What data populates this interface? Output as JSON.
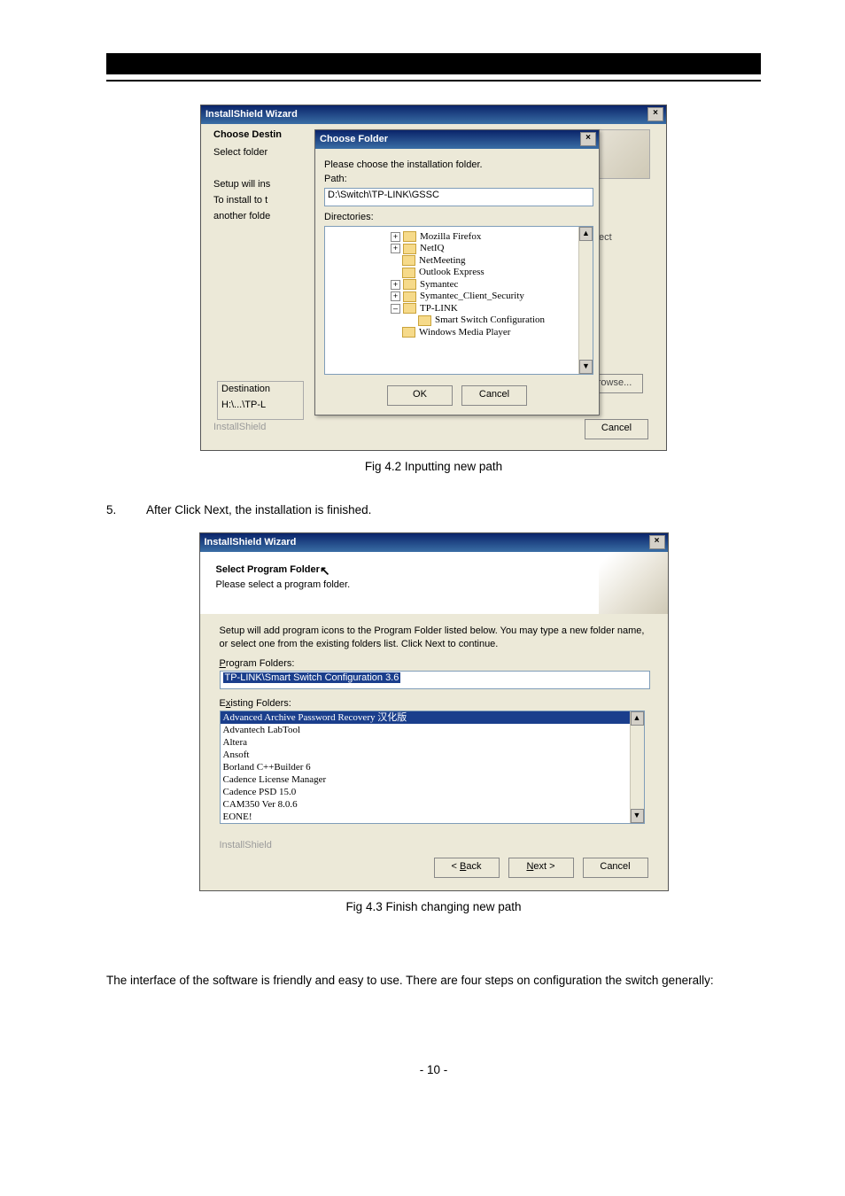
{
  "figure1": {
    "outer_title": "InstallShield Wizard",
    "left": {
      "header": "Choose Destin",
      "select_folder": "Select folder",
      "setup_will": "Setup will ins",
      "to_install": "To install to t",
      "another": "another folde",
      "dest_label": "Destination",
      "dest_path": "H:\\...\\TP-L",
      "installshield": "InstallShield"
    },
    "right": {
      "select": "select",
      "browse": "rowse...",
      "cancel": "Cancel"
    },
    "inner": {
      "title": "Choose Folder",
      "prompt": "Please choose the installation folder.",
      "path_label": "Path:",
      "path_value": "D:\\Switch\\TP-LINK\\GSSC",
      "dirs_label": "Directories:",
      "tree": {
        "n0": "Mozilla Firefox",
        "n1": "NetIQ",
        "n2": "NetMeeting",
        "n3": "Outlook Express",
        "n4": "Symantec",
        "n5": "Symantec_Client_Security",
        "n6": "TP-LINK",
        "n6a": "Smart Switch Configuration",
        "n7": "Windows Media Player"
      },
      "ok": "OK",
      "cancel": "Cancel"
    },
    "caption": "Fig 4.2 Inputting new path"
  },
  "step5": {
    "num": "5.",
    "text": "After Click Next, the installation is finished."
  },
  "figure2": {
    "title": "InstallShield Wizard",
    "header": "Select Program Folder",
    "header_sub": "Please select a program folder.",
    "intro": "Setup will add program icons to the Program Folder listed below.  You may type a new folder name, or select one from the existing folders list.  Click Next to continue.",
    "pf_label_pre": "P",
    "pf_label_rest": "rogram Folders:",
    "pf_value": "TP-LINK\\Smart Switch Configuration 3.6",
    "ef_label_pre": "E",
    "ef_label_rest": "xisting Folders:",
    "ef": {
      "i0": "Advanced Archive Password Recovery 汉化版",
      "i1": "Advantech LabTool",
      "i2": "Altera",
      "i3": "Ansoft",
      "i4": "Borland C++Builder 6",
      "i5": "Cadence License Manager",
      "i6": "Cadence PSD 15.0",
      "i7": "CAM350 Ver 8.0.6",
      "i8": "EONE!"
    },
    "installshield": "InstallShield",
    "back": "< Back",
    "next": "Next >",
    "cancel": "Cancel",
    "caption": "Fig 4.3 Finish changing new path"
  },
  "para": "The interface of the software is friendly and easy to use. There are four steps on configuration the switch generally:",
  "pagenum": "- 10 -"
}
